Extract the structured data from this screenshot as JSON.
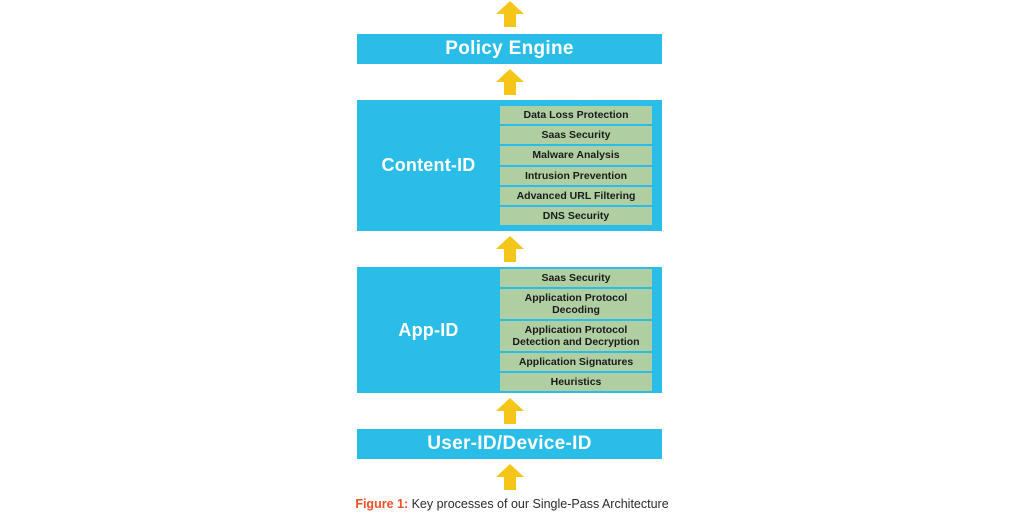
{
  "diagram": {
    "title": "Key processes of our Single-Pass Architecture",
    "colors": {
      "panel_blue": "#29BDE8",
      "chip_green": "#AFCFA3",
      "arrow_yellow": "#F5C518",
      "caption_accent": "#F04E23",
      "background": "#FFFFFF"
    },
    "flow_direction": "bottom-to-top",
    "layers": [
      {
        "id": "policy-engine",
        "type": "bar",
        "label": "Policy Engine",
        "items": []
      },
      {
        "id": "content-id",
        "type": "panel",
        "label": "Content-ID",
        "items": [
          "Data Loss Protection",
          "Saas Security",
          "Malware Analysis",
          "Intrusion Prevention",
          "Advanced URL Filtering",
          "DNS Security"
        ]
      },
      {
        "id": "app-id",
        "type": "panel",
        "label": "App-ID",
        "items": [
          "Saas Security",
          "Application Protocol Decoding",
          "Application Protocol Detection and Decryption",
          "Application Signatures",
          "Heuristics"
        ]
      },
      {
        "id": "user-id-device-id",
        "type": "bar",
        "label": "User-ID/Device-ID",
        "items": []
      }
    ],
    "arrows": {
      "icon": "arrow-up-icon",
      "count": 5,
      "direction": "up"
    },
    "caption": {
      "figure_label": "Figure 1:",
      "figure_text": " Key processes of our Single-Pass Architecture"
    }
  }
}
